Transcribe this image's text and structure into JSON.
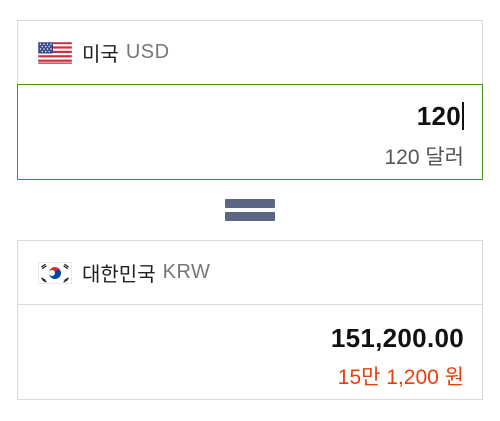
{
  "from": {
    "country": "미국",
    "code": "USD",
    "flag_icon": "us-flag-icon",
    "amount": "120",
    "amount_words": "120 달러",
    "active_border_color": "#3f9a1c"
  },
  "equals_icon": "equals-icon",
  "to": {
    "country": "대한민국",
    "code": "KRW",
    "flag_icon": "kr-flag-icon",
    "amount": "151,200.00",
    "amount_words": "15만 1,200 원",
    "words_color": "#e8400c"
  }
}
